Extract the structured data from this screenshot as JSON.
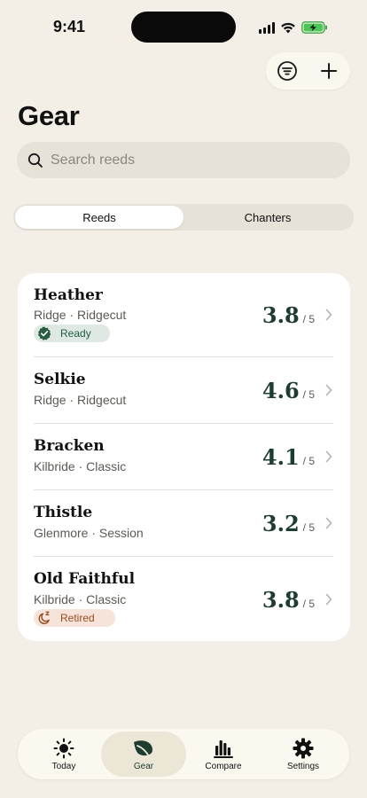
{
  "status": {
    "time": "9:41"
  },
  "header": {
    "title": "Gear"
  },
  "search": {
    "placeholder": "Search reeds"
  },
  "segments": [
    {
      "label": "Reeds",
      "active": true
    },
    {
      "label": "Chanters",
      "active": false
    }
  ],
  "reeds": [
    {
      "name": "Heather",
      "sub": "Ridge · Ridgecut",
      "rating": "3.8",
      "max": "/ 5",
      "badge": "Ready"
    },
    {
      "name": "Selkie",
      "sub": "Ridge · Ridgecut",
      "rating": "4.6",
      "max": "/ 5"
    },
    {
      "name": "Bracken",
      "sub": "Kilbride · Classic",
      "rating": "4.1",
      "max": "/ 5"
    },
    {
      "name": "Thistle",
      "sub": "Glenmore · Session",
      "rating": "3.2",
      "max": "/ 5"
    },
    {
      "name": "Old Faithful",
      "sub": "Kilbride · Classic",
      "rating": "3.8",
      "max": "/ 5",
      "badge": "Retired"
    }
  ],
  "tabs": [
    {
      "label": "Today",
      "icon": "sun-icon"
    },
    {
      "label": "Gear",
      "icon": "leaf-icon",
      "active": true
    },
    {
      "label": "Compare",
      "icon": "bar-chart-icon"
    },
    {
      "label": "Settings",
      "icon": "gear-icon"
    }
  ],
  "colors": {
    "background": "#f3efe6",
    "accent": "#1d3d30",
    "ready_badge": "#dde9e2",
    "retired_badge": "#f6e3d9"
  }
}
